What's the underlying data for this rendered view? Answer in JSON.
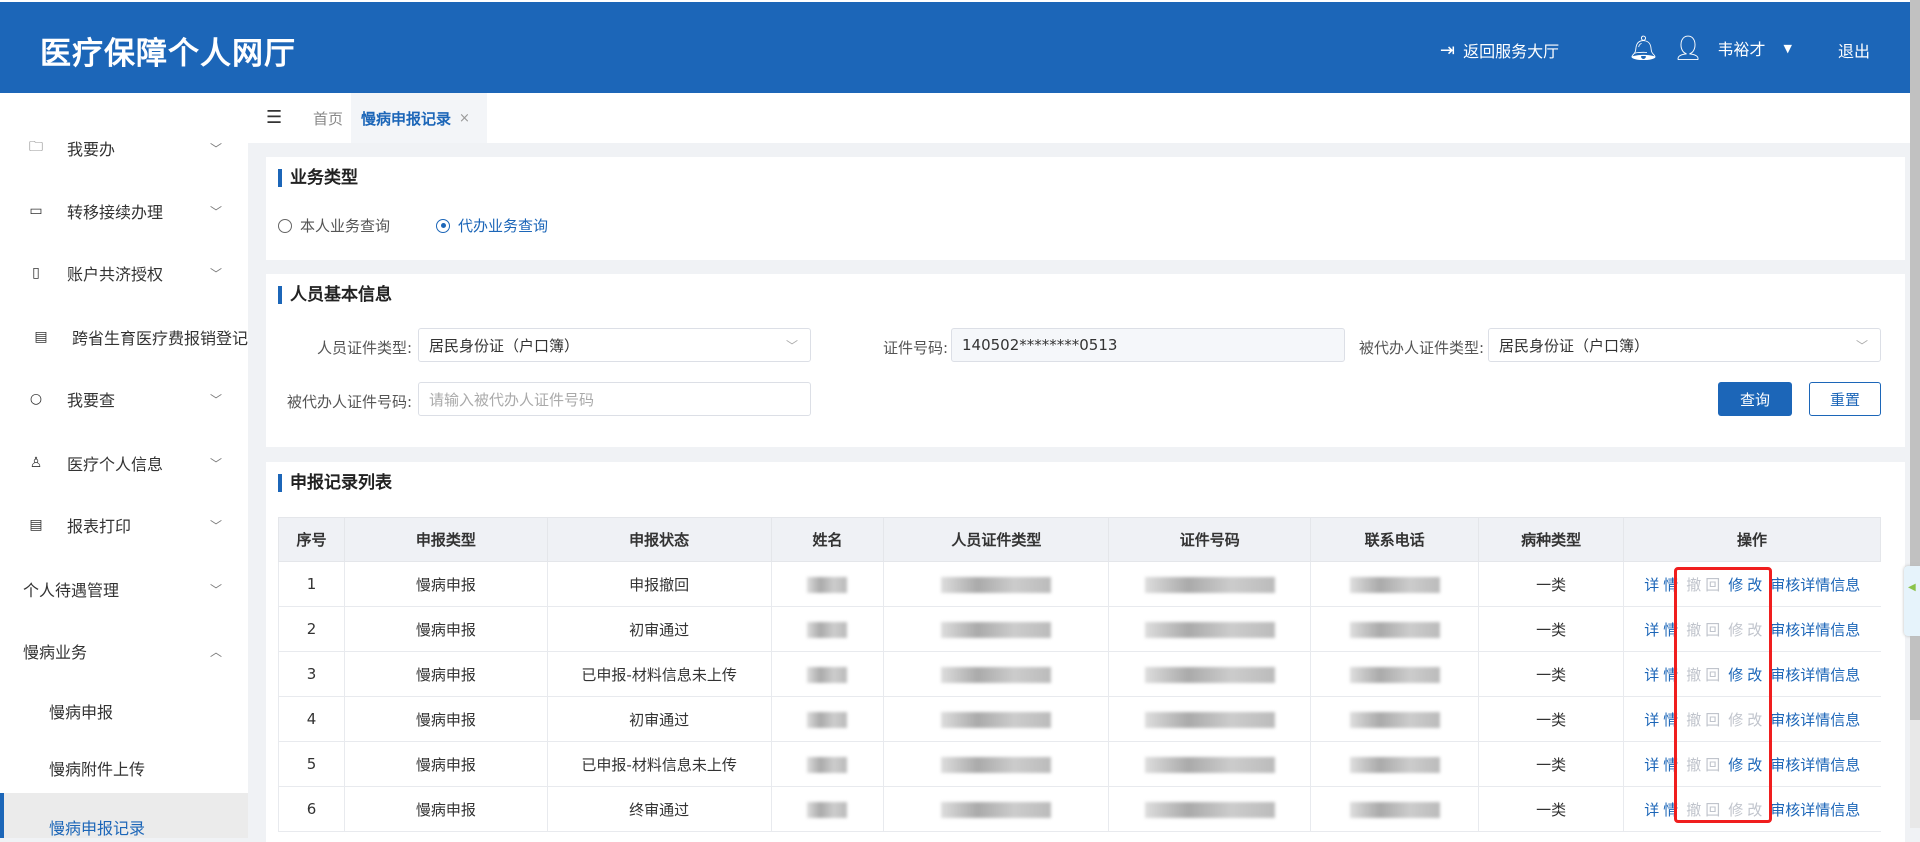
{
  "header": {
    "title": "医疗保障个人网厅",
    "back_label": "返回服务大厅",
    "user_name": "韦裕才",
    "logout_label": "退出"
  },
  "sidebar": {
    "items": [
      {
        "label": "我要办"
      },
      {
        "label": "转移接续办理"
      },
      {
        "label": "账户共济授权"
      },
      {
        "label": "跨省生育医疗费报销登记"
      },
      {
        "label": "我要查"
      },
      {
        "label": "医疗个人信息"
      },
      {
        "label": "报表打印"
      },
      {
        "label": "个人待遇管理"
      },
      {
        "label": "慢病业务"
      },
      {
        "label": "慢病申报"
      },
      {
        "label": "慢病附件上传"
      },
      {
        "label": "慢病申报记录"
      }
    ]
  },
  "tabs": {
    "home": "首页",
    "active": "慢病申报记录",
    "close": "×"
  },
  "business_type": {
    "title": "业务类型",
    "options": [
      "本人业务查询",
      "代办业务查询"
    ],
    "selected": 1
  },
  "person_info": {
    "title": "人员基本信息",
    "cert_type_label": "人员证件类型:",
    "cert_type_value": "居民身份证（户口簿）",
    "cert_no_label": "证件号码:",
    "cert_no_value": "140502********0513",
    "agent_cert_type_label": "被代办人证件类型:",
    "agent_cert_type_value": "居民身份证（户口簿）",
    "agent_cert_no_label": "被代办人证件号码:",
    "agent_cert_no_placeholder": "请输入被代办人证件号码",
    "query_label": "查询",
    "reset_label": "重置"
  },
  "records": {
    "title": "申报记录列表",
    "columns": [
      "序号",
      "申报类型",
      "申报状态",
      "姓名",
      "人员证件类型",
      "证件号码",
      "联系电话",
      "病种类型",
      "操作"
    ],
    "rows": [
      {
        "no": "1",
        "type": "慢病申报",
        "status": "申报撤回",
        "disease": "一类",
        "edit_enabled": true
      },
      {
        "no": "2",
        "type": "慢病申报",
        "status": "初审通过",
        "disease": "一类",
        "edit_enabled": false
      },
      {
        "no": "3",
        "type": "慢病申报",
        "status": "已申报-材料信息未上传",
        "disease": "一类",
        "edit_enabled": true
      },
      {
        "no": "4",
        "type": "慢病申报",
        "status": "初审通过",
        "disease": "一类",
        "edit_enabled": false
      },
      {
        "no": "5",
        "type": "慢病申报",
        "status": "已申报-材料信息未上传",
        "disease": "一类",
        "edit_enabled": true
      },
      {
        "no": "6",
        "type": "慢病申报",
        "status": "终审通过",
        "disease": "一类",
        "edit_enabled": false
      }
    ],
    "actions": {
      "detail": "详情",
      "withdraw": "撤回",
      "edit": "修改",
      "audit": "审核详情信息"
    }
  },
  "colors": {
    "brand": "#1c66b8",
    "highlight": "#f01e1e"
  }
}
